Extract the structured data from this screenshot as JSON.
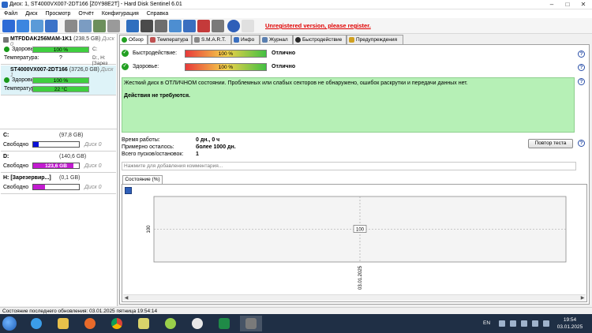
{
  "window": {
    "title": "Диск: 1, ST4000VX007-2DT166 [Z0Y98E2T]  -  Hard Disk Sentinel 6.01"
  },
  "menu": [
    "Файл",
    "Диск",
    "Просмотр",
    "Отчёт",
    "Конфигурация",
    "Справка"
  ],
  "toolbar": {
    "unregistered_link": "Unregistered version, please register."
  },
  "disks": [
    {
      "name": "MTFDDAK256MAM-1K1",
      "capacity": "(238,5 GB)",
      "disk_label": "Диск 0",
      "health_label": "Здоровье:",
      "health_value": "100 %",
      "health_fraction": 1.0,
      "health_ext": "C:",
      "temp_label": "Температура:",
      "temp_value": "?",
      "temp_ext": "D:, H: [Зарез"
    },
    {
      "name": "ST4000VX007-2DT166",
      "capacity": "(3726,0 GB)",
      "disk_label": "Диск 1",
      "health_label": "Здоровье:",
      "health_value": "100 %",
      "health_fraction": 1.0,
      "health_ext": "",
      "temp_label": "Температура:",
      "temp_value": "22 °C",
      "temp_ext": ""
    }
  ],
  "volumes": [
    {
      "name": "C:",
      "size": "(97,8 GB)",
      "free_label": "Свободно",
      "free_value": "11,7 GB",
      "free_fraction": 0.12,
      "fill_color": "#0a10d8",
      "disk": "Диск 0"
    },
    {
      "name": "D:",
      "size": "(140,6 GB)",
      "free_label": "Свободно",
      "free_value": "123,6 GB",
      "free_fraction": 0.88,
      "fill_color": "#c21bd0",
      "disk": "Диск 0"
    },
    {
      "name": "H: [Зарезервир...]",
      "size": "(0,1 GB)",
      "free_label": "Свободно",
      "free_value": "0,1 GB",
      "free_fraction": 0.25,
      "fill_color": "#c21bd0",
      "disk": "Диск 0"
    }
  ],
  "tabs": [
    "Обзор",
    "Температура",
    "S.M.A.R.T.",
    "Инфо",
    "Журнал",
    "Быстродействие",
    "Предупреждения"
  ],
  "overview": {
    "performance_label": "Быстродействие:",
    "performance_value": "100 %",
    "performance_result": "Отлично",
    "health_label": "Здоровье:",
    "health_value": "100 %",
    "health_result": "Отлично",
    "message": "Жесткий диск в ОТЛИЧНОМ состоянии. Проблемных или слабых секторов не обнаружено, ошибок раскрутки и передачи данных нет.",
    "action": "Действия не требуются.",
    "uptime_label": "Время работы:",
    "uptime_value": "0 дн., 0 ч",
    "remaining_label": "Примерно осталось:",
    "remaining_value": "более 1000 дн.",
    "starts_label": "Всего пусков/остановок:",
    "starts_value": "1",
    "retest_button": "Повтор теста",
    "comment_placeholder": "Нажмите для добавления комментария...",
    "state_tab": "Состояние (%)"
  },
  "chart_data": {
    "type": "line",
    "x": [
      "03.01.2025"
    ],
    "y": [
      100
    ],
    "ylabel": "100",
    "point_label": "100"
  },
  "statusbar": {
    "text": "Состояние последнего обновления: 03.01.2025 пятница 19:54:14"
  },
  "taskbar": {
    "lang": "EN",
    "time": "19:54",
    "date": "03.01.2025"
  },
  "colors": {
    "health_bar": "#3fcf3f",
    "ok_green": "#b6f0b6",
    "unregistered": "#e00000"
  }
}
